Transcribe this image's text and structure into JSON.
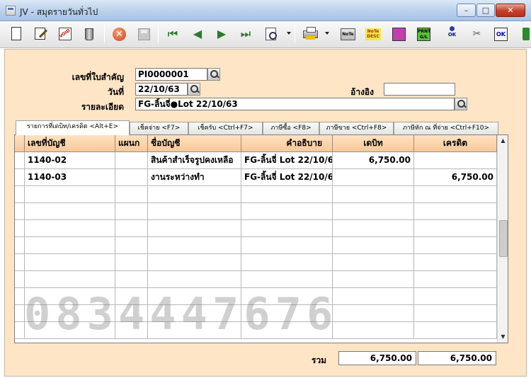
{
  "window": {
    "title": "JV - สมุดรายวันทั่วไป",
    "minimize_label": "–",
    "maximize_label": "□",
    "close_label": "✕"
  },
  "toolbar": {
    "note_label": "NoTe",
    "desc_label": "NoTe DESC",
    "print_gl_label": "PRNT G/L",
    "ok_label": "OK",
    "ok2_label": "OK",
    "cancel_glyph": "✕",
    "first_glyph": "⏮",
    "prev_glyph": "◀",
    "next_glyph": "▶",
    "last_glyph": "⏭",
    "link_glyph": "✂"
  },
  "header": {
    "doc_no_label": "เลขที่ใบสำคัญ",
    "doc_no_value": "PI0000001",
    "date_label": "วันที่",
    "date_value": "22/10/63",
    "reference_label": "อ้างอิง",
    "reference_value": "",
    "detail_label": "รายละเอียด",
    "detail_value": "FG-ลิ้นจี่●Lot 22/10/63"
  },
  "tabs": [
    {
      "label": "รายการที่เดบิท/เครดิต <Alt+E>",
      "active": true
    },
    {
      "label": "เช็คจ่าย <F7>",
      "active": false
    },
    {
      "label": "เช็ครับ <Ctrl+F7>",
      "active": false
    },
    {
      "label": "ภาษีซื้อ <F8>",
      "active": false
    },
    {
      "label": "ภาษีขาย <Ctrl+F8>",
      "active": false
    },
    {
      "label": "ภาษีหัก ณ ที่จ่าย <Ctrl+F10>",
      "active": false
    }
  ],
  "grid": {
    "columns": [
      "เลขที่บัญชี",
      "แผนก",
      "ชื่อบัญชี",
      "คำอธิบาย",
      "เดบิท",
      "เครดิต"
    ],
    "rows": [
      {
        "account": "1140-02",
        "dept": "",
        "name": "สินค้าสำเร็จรูปคงเหลือ",
        "desc": "FG-ลิ้นจี่ Lot 22/10/6",
        "debit": "6,750.00",
        "credit": ""
      },
      {
        "account": "1140-03",
        "dept": "",
        "name": "งานระหว่างทำ",
        "desc": "FG-ลิ้นจี่ Lot 22/10/6",
        "debit": "",
        "credit": "6,750.00"
      }
    ],
    "empty_rows": 9,
    "scroll_up": "▲",
    "scroll_down": "▼"
  },
  "watermark": "0834447676",
  "totals": {
    "label": "รวม",
    "debit_total": "6,750.00",
    "credit_total": "6,750.00"
  },
  "colors": {
    "form_background": "#fde5c5",
    "header_background": "#f8c89a"
  }
}
